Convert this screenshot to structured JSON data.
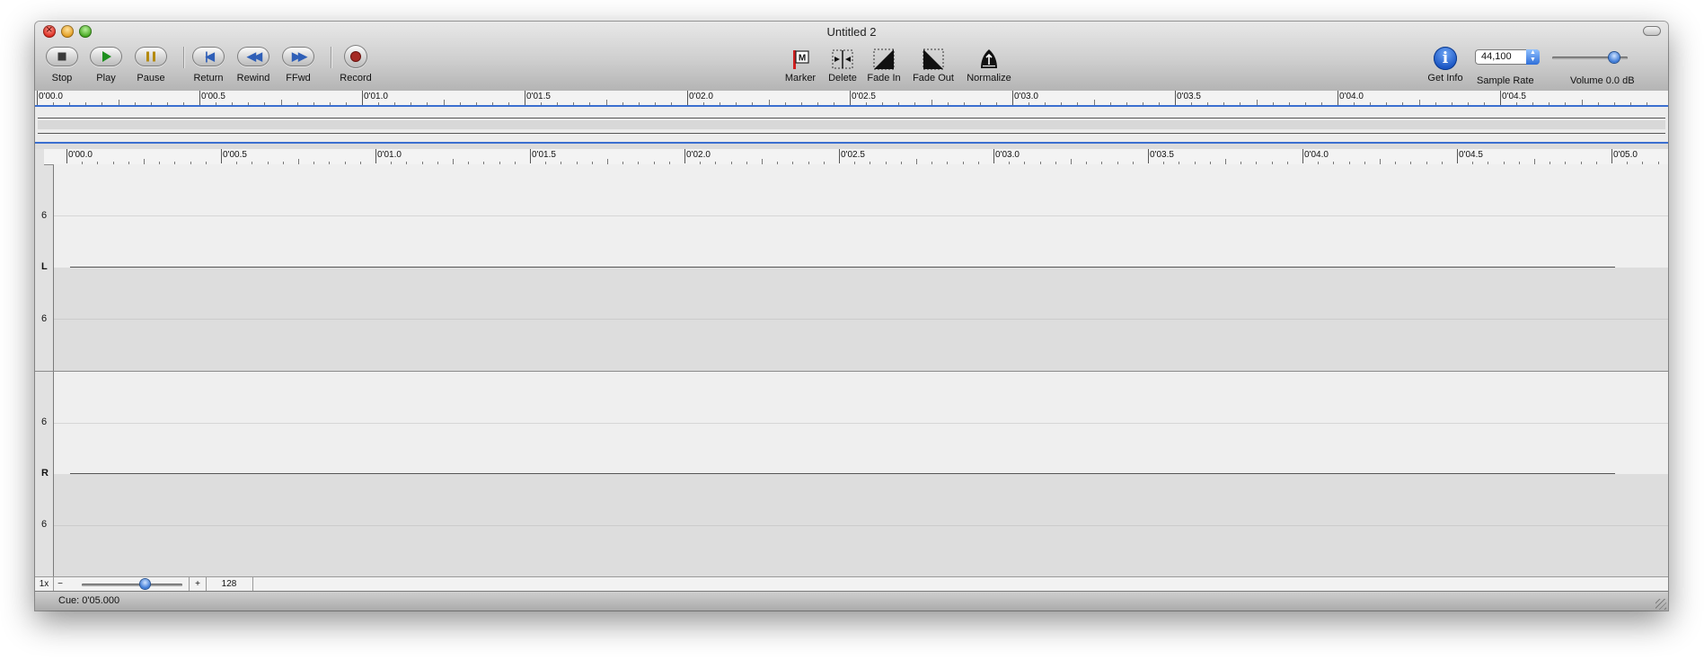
{
  "window": {
    "title": "Untitled 2"
  },
  "toolbar": {
    "transport": [
      {
        "id": "stop",
        "label": "Stop"
      },
      {
        "id": "play",
        "label": "Play"
      },
      {
        "id": "pause",
        "label": "Pause"
      },
      {
        "id": "return",
        "label": "Return"
      },
      {
        "id": "rewind",
        "label": "Rewind"
      },
      {
        "id": "ffwd",
        "label": "FFwd"
      },
      {
        "id": "record",
        "label": "Record"
      }
    ],
    "edit": [
      {
        "id": "marker",
        "label": "Marker",
        "icon": "marker-flag-icon"
      },
      {
        "id": "delete",
        "label": "Delete",
        "icon": "delete-collapse-icon"
      },
      {
        "id": "fade_in",
        "label": "Fade In",
        "icon": "fade-in-icon"
      },
      {
        "id": "fade_out",
        "label": "Fade Out",
        "icon": "fade-out-icon"
      },
      {
        "id": "normalize",
        "label": "Normalize",
        "icon": "normalize-icon"
      }
    ],
    "get_info": {
      "label": "Get Info"
    },
    "sample_rate": {
      "label": "Sample Rate",
      "value": "44,100"
    },
    "volume": {
      "label": "Volume 0.0 dB",
      "level_fraction": 0.82
    }
  },
  "overview_ruler": {
    "ticks": [
      "0'00.0",
      "0'00.5",
      "0'01.0",
      "0'01.5",
      "0'02.0",
      "0'02.5",
      "0'03.0",
      "0'03.5",
      "0'04.0",
      "0'04.5"
    ]
  },
  "main_ruler": {
    "ticks": [
      "0'00.0",
      "0'00.5",
      "0'01.0",
      "0'01.5",
      "0'02.0",
      "0'02.5",
      "0'03.0",
      "0'03.5",
      "0'04.0",
      "0'04.5",
      "0'05.0"
    ]
  },
  "tracks": [
    {
      "channel": "L",
      "scale_upper": "6",
      "scale_lower": "6"
    },
    {
      "channel": "R",
      "scale_upper": "6",
      "scale_lower": "6"
    }
  ],
  "zoom": {
    "factor": "1x",
    "samples_per_pixel": "128",
    "slider_fraction": 0.63
  },
  "status": {
    "cue": "Cue: 0'05.000"
  },
  "colors": {
    "accent_blue": "#3b6fd0",
    "record_red": "#a52a24",
    "play_green": "#1e8f1e"
  }
}
